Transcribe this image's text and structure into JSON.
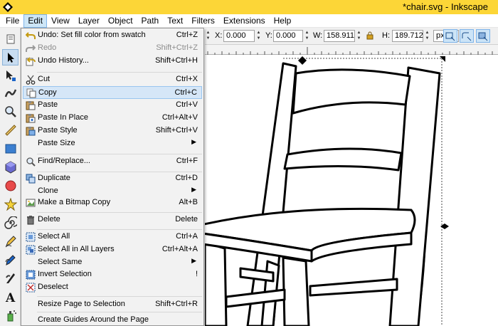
{
  "window": {
    "title": "*chair.svg - Inkscape"
  },
  "menubar": {
    "items": [
      {
        "label": "File"
      },
      {
        "label": "Edit",
        "active": true
      },
      {
        "label": "View"
      },
      {
        "label": "Layer"
      },
      {
        "label": "Object"
      },
      {
        "label": "Path"
      },
      {
        "label": "Text"
      },
      {
        "label": "Filters"
      },
      {
        "label": "Extensions"
      },
      {
        "label": "Help"
      }
    ]
  },
  "controls": {
    "x_label": "X:",
    "x_value": "0.000",
    "y_label": "Y:",
    "y_value": "0.000",
    "w_label": "W:",
    "w_value": "158.911",
    "h_label": "H:",
    "h_value": "189.712",
    "unit": "px"
  },
  "edit_menu": {
    "items": [
      {
        "label": "Undo: Set fill color from swatch",
        "shortcut": "Ctrl+Z",
        "icon": "undo-icon"
      },
      {
        "label": "Redo",
        "shortcut": "Shift+Ctrl+Z",
        "icon": "redo-icon",
        "disabled": true
      },
      {
        "label": "Undo History...",
        "shortcut": "Shift+Ctrl+H",
        "icon": "undo-history-icon"
      },
      {
        "label": "Cut",
        "shortcut": "Ctrl+X",
        "icon": "cut-icon"
      },
      {
        "label": "Copy",
        "shortcut": "Ctrl+C",
        "icon": "copy-icon",
        "highlighted": true
      },
      {
        "label": "Paste",
        "shortcut": "Ctrl+V",
        "icon": "paste-icon"
      },
      {
        "label": "Paste In Place",
        "shortcut": "Ctrl+Alt+V",
        "icon": "paste-in-place-icon"
      },
      {
        "label": "Paste Style",
        "shortcut": "Shift+Ctrl+V",
        "icon": "paste-style-icon"
      },
      {
        "label": "Paste Size",
        "shortcut": "",
        "icon": "",
        "submenu": true
      },
      {
        "label": "Find/Replace...",
        "shortcut": "Ctrl+F",
        "icon": "find-icon"
      },
      {
        "label": "Duplicate",
        "shortcut": "Ctrl+D",
        "icon": "duplicate-icon"
      },
      {
        "label": "Clone",
        "shortcut": "",
        "icon": "",
        "submenu": true
      },
      {
        "label": "Make a Bitmap Copy",
        "shortcut": "Alt+B",
        "icon": "bitmap-copy-icon"
      },
      {
        "label": "Delete",
        "shortcut": "Delete",
        "icon": "delete-icon"
      },
      {
        "label": "Select All",
        "shortcut": "Ctrl+A",
        "icon": "select-all-icon"
      },
      {
        "label": "Select All in All Layers",
        "shortcut": "Ctrl+Alt+A",
        "icon": "select-all-layers-icon"
      },
      {
        "label": "Select Same",
        "shortcut": "",
        "icon": "",
        "submenu": true
      },
      {
        "label": "Invert Selection",
        "shortcut": "!",
        "icon": "invert-selection-icon"
      },
      {
        "label": "Deselect",
        "shortcut": "",
        "icon": "deselect-icon"
      },
      {
        "label": "Resize Page to Selection",
        "shortcut": "Shift+Ctrl+R",
        "icon": ""
      },
      {
        "label": "Create Guides Around the Page",
        "shortcut": "",
        "icon": ""
      }
    ]
  }
}
